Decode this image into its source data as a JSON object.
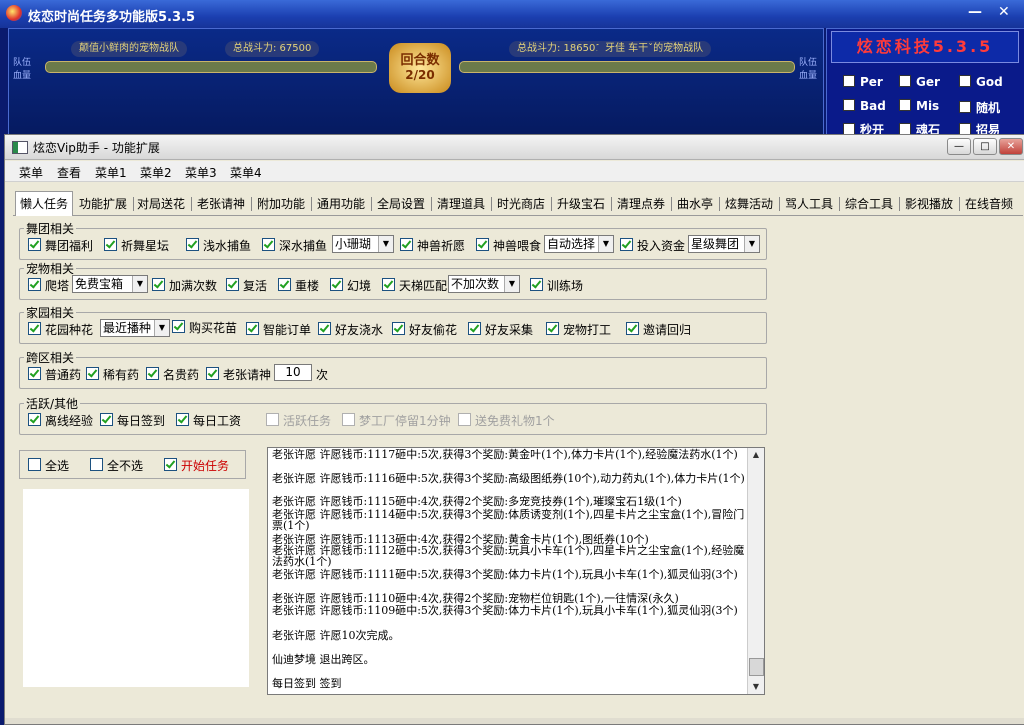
{
  "bg_window": {
    "title": "炫恋时尚任务多功能版5.3.5",
    "minimize": "—",
    "close": "✕",
    "left_team": "颠值小鲜肉的宠物战队",
    "left_power": "总战斗力: 67500",
    "right_power": "总战斗力: 186501",
    "right_team": "牙佳 车干ˇ的宠物战队",
    "round_label": "回合数",
    "round_value": "2/20",
    "left_side_label": "队伍\n血量",
    "right_side_label": "队伍\n血量",
    "brand": "炫恋科技5.3.5",
    "options": [
      "Per",
      "Ger",
      "God",
      "Bad",
      "Mis",
      "随机",
      "秒开",
      "魂石",
      "招易"
    ]
  },
  "window": {
    "title": "炫恋Vip助手 - 功能扩展",
    "min": "—",
    "max": "□",
    "close": "✕"
  },
  "menu": [
    "菜单",
    "查看",
    "菜单1",
    "菜单2",
    "菜单3",
    "菜单4"
  ],
  "tabs": [
    "懒人任务",
    "功能扩展",
    "对局送花",
    "老张请神",
    "附加功能",
    "通用功能",
    "全局设置",
    "清理道具",
    "时光商店",
    "升级宝石",
    "清理点券",
    "曲水亭",
    "炫舞活动",
    "骂人工具",
    "综合工具",
    "影视播放",
    "在线音频"
  ],
  "groups": {
    "dance": {
      "title": "舞团相关",
      "items": [
        "舞团福利",
        "祈舞星坛",
        "浅水捕鱼",
        "深水捕鱼",
        "神兽祈愿",
        "神兽喂食",
        "投入资金"
      ],
      "select1": "小珊瑚",
      "select2": "自动选择",
      "select3": "星级舞团"
    },
    "pet": {
      "title": "宠物相关",
      "items": [
        "爬塔",
        "加满次数",
        "复活",
        "重楼",
        "幻境",
        "天梯匹配",
        "训练场"
      ],
      "select1": "免费宝箱",
      "select2": "不加次数"
    },
    "home": {
      "title": "家园相关",
      "items": [
        "花园种花",
        "购买花苗",
        "智能订单",
        "好友浇水",
        "好友偷花",
        "好友采集",
        "宠物打工",
        "邀请回归"
      ],
      "select1": "最近播种"
    },
    "cross": {
      "title": "跨区相关",
      "items": [
        "普通药",
        "稀有药",
        "名贵药",
        "老张请神"
      ],
      "count": "10",
      "unit": "次"
    },
    "active": {
      "title": "活跃/其他",
      "items": [
        "离线经验",
        "每日签到",
        "每日工资",
        "活跃任务",
        "梦工厂停留1分钟",
        "送免费礼物1个"
      ]
    }
  },
  "controls": {
    "select_all": "全选",
    "select_none": "全不选",
    "start": "开始任务"
  },
  "log": [
    "老张许愿  许愿钱币:1117砸中:5次,获得3个奖励:黄金叶(1个),体力卡片(1个),经验魔法药水(1个)",
    "老张许愿  许愿钱币:1116砸中:5次,获得3个奖励:高级图纸券(10个),动力药丸(1个),体力卡片(1个)",
    "老张许愿  许愿钱币:1115砸中:4次,获得2个奖励:多宠竞技券(1个),璀璨宝石1级(1个)",
    "老张许愿  许愿钱币:1114砸中:5次,获得3个奖励:体质诱变剂(1个),四星卡片之尘宝盒(1个),冒险门票(1个)",
    "老张许愿  许愿钱币:1113砸中:4次,获得2个奖励:黄金卡片(1个),图纸券(10个)",
    "老张许愿  许愿钱币:1112砸中:5次,获得3个奖励:玩具小卡车(1个),四星卡片之尘宝盒(1个),经验魔法药水(1个)",
    "老张许愿  许愿钱币:1111砸中:5次,获得3个奖励:体力卡片(1个),玩具小卡车(1个),狐灵仙羽(3个)",
    "老张许愿  许愿钱币:1110砸中:4次,获得2个奖励:宠物栏位钥匙(1个),一往情深(永久)",
    "老张许愿  许愿钱币:1109砸中:5次,获得3个奖励:体力卡片(1个),玩具小卡车(1个),狐灵仙羽(3个)",
    "老张许愿  许愿10次完成。",
    "仙迪梦境  退出跨区。",
    "每日签到  签到"
  ],
  "colors": {
    "accent_red": "#cc0000",
    "check_green": "#21a121"
  }
}
